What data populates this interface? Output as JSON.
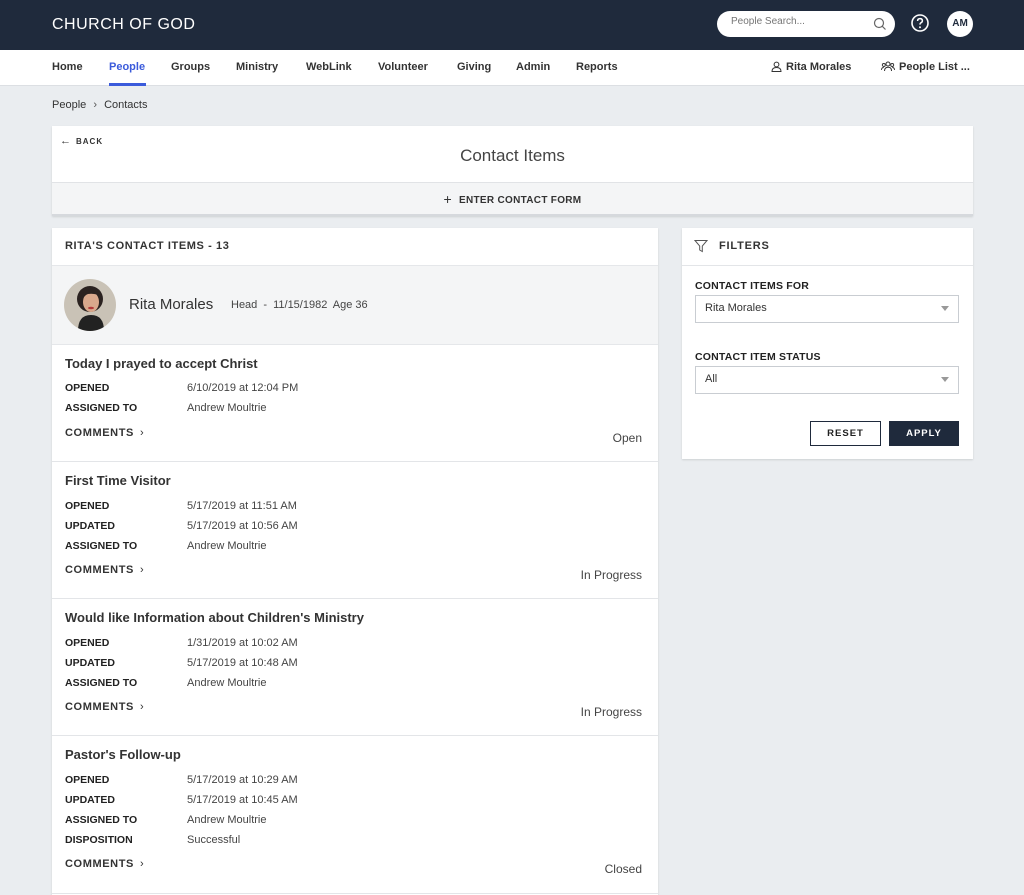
{
  "app": {
    "brand": "CHURCH OF GOD"
  },
  "header": {
    "search_placeholder": "People Search...",
    "user_initials": "AM"
  },
  "nav": {
    "items": [
      "Home",
      "People",
      "Groups",
      "Ministry",
      "WebLink",
      "Volunteer",
      "Giving",
      "Admin",
      "Reports"
    ],
    "active": "People",
    "user_link": "Rita Morales",
    "people_list_link": "People List ..."
  },
  "breadcrumb": {
    "root": "People",
    "separator": "›",
    "current": "Contacts"
  },
  "contact_header": {
    "back_label": "BACK",
    "title": "Contact Items",
    "enter_form_label": "ENTER CONTACT FORM"
  },
  "list": {
    "title": "RITA'S CONTACT ITEMS - 13",
    "person": {
      "name": "Rita Morales",
      "role": "Head",
      "dash": "-",
      "dob": "11/15/1982",
      "age": "Age 36"
    },
    "comments_label": "COMMENTS",
    "items": [
      {
        "title": "Today I prayed to accept Christ",
        "fields": [
          {
            "label": "OPENED",
            "value": "6/10/2019 at 12:04 PM"
          },
          {
            "label": "ASSIGNED TO",
            "value": "Andrew Moultrie"
          }
        ],
        "status": "Open"
      },
      {
        "title": "First Time Visitor",
        "fields": [
          {
            "label": "OPENED",
            "value": "5/17/2019 at 11:51 AM"
          },
          {
            "label": "UPDATED",
            "value": "5/17/2019 at 10:56 AM"
          },
          {
            "label": "ASSIGNED TO",
            "value": "Andrew Moultrie"
          }
        ],
        "status": "In Progress"
      },
      {
        "title": "Would like Information about Children's Ministry",
        "fields": [
          {
            "label": "OPENED",
            "value": "1/31/2019 at 10:02 AM"
          },
          {
            "label": "UPDATED",
            "value": "5/17/2019 at 10:48 AM"
          },
          {
            "label": "ASSIGNED TO",
            "value": "Andrew Moultrie"
          }
        ],
        "status": "In Progress"
      },
      {
        "title": "Pastor's Follow-up",
        "fields": [
          {
            "label": "OPENED",
            "value": "5/17/2019 at 10:29 AM"
          },
          {
            "label": "UPDATED",
            "value": "5/17/2019 at 10:45 AM"
          },
          {
            "label": "ASSIGNED TO",
            "value": "Andrew Moultrie"
          },
          {
            "label": "DISPOSITION",
            "value": "Successful"
          }
        ],
        "status": "Closed"
      }
    ]
  },
  "filters": {
    "title": "FILTERS",
    "contact_items_for_label": "CONTACT ITEMS FOR",
    "contact_items_for_value": "Rita Morales",
    "status_label": "CONTACT ITEM STATUS",
    "status_value": "All",
    "reset_label": "RESET",
    "apply_label": "APPLY"
  },
  "colors": {
    "topbar": "#1f2a3c",
    "accent": "#3b5bdb",
    "background": "#eaedf0"
  }
}
